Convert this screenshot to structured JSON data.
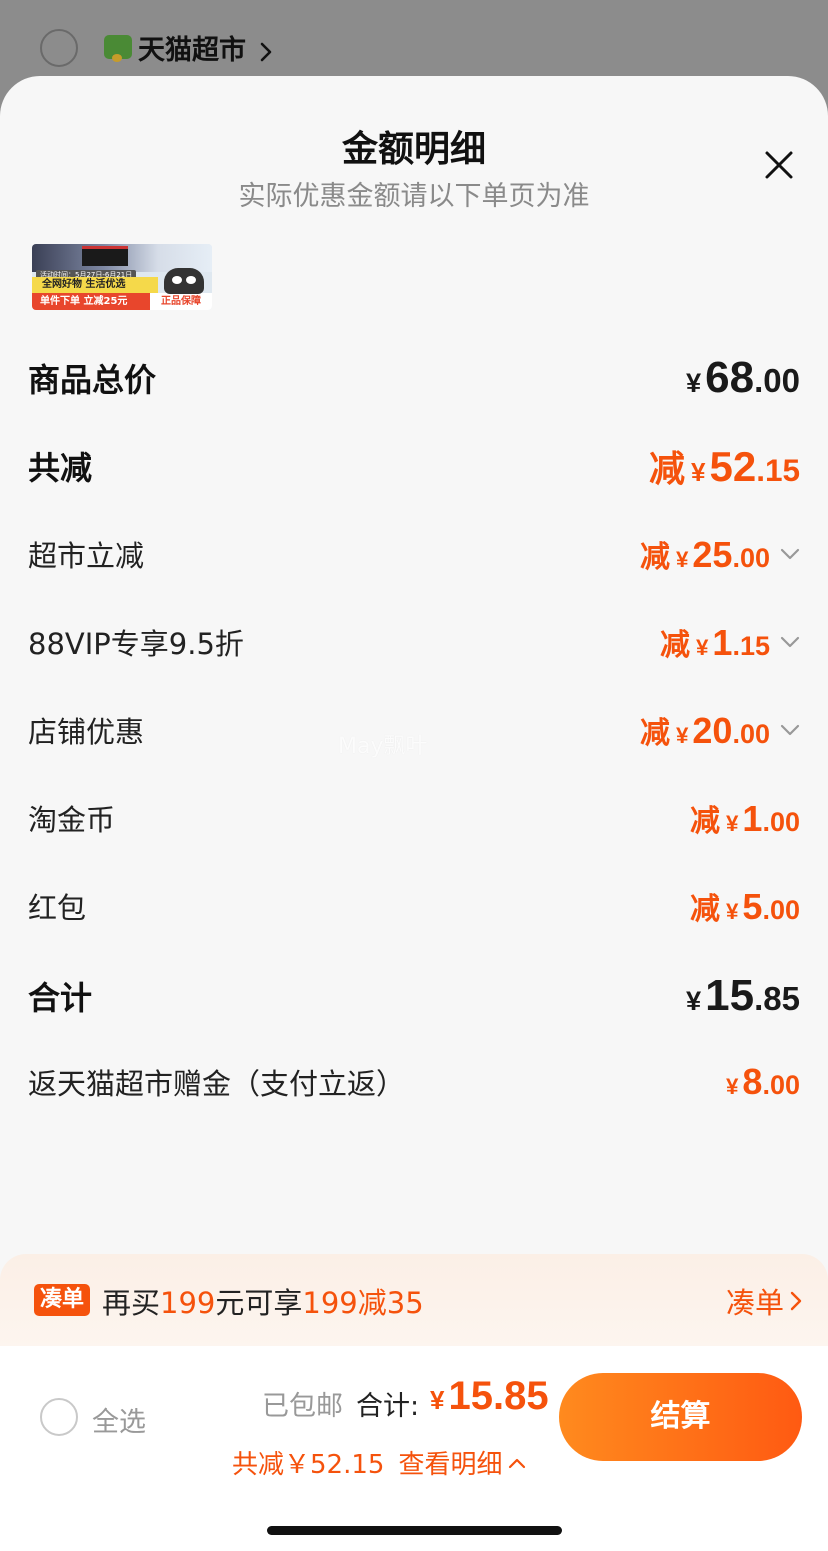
{
  "background": {
    "store_name": "天猫超市",
    "logo_text": "超市"
  },
  "sheet": {
    "title": "金额明细",
    "subtitle": "实际优惠金额请以下单页为准"
  },
  "banner": {
    "date": "活动时间：5月27日-6月21日",
    "line1": "全网好物 生活优选",
    "line2": "单件下单 立减25元",
    "badge": "正品保障"
  },
  "rows": {
    "total_price": {
      "label": "商品总价",
      "yen": "¥",
      "int": "68",
      "dec": ".00"
    },
    "total_reduce": {
      "label": "共减",
      "prefix": "减",
      "yen": "¥",
      "int": "52",
      "dec": ".15"
    },
    "market_reduce": {
      "label": "超市立减",
      "prefix": "减",
      "yen": "¥",
      "int": "25",
      "dec": ".00"
    },
    "vip": {
      "label": "88VIP专享9.5折",
      "prefix": "减",
      "yen": "¥",
      "int": "1",
      "dec": ".15"
    },
    "shop": {
      "label": "店铺优惠",
      "prefix": "减",
      "yen": "¥",
      "int": "20",
      "dec": ".00"
    },
    "coins": {
      "label": "淘金币",
      "prefix": "减",
      "yen": "¥",
      "int": "1",
      "dec": ".00"
    },
    "redpacket": {
      "label": "红包",
      "prefix": "减",
      "yen": "¥",
      "int": "5",
      "dec": ".00"
    },
    "subtotal": {
      "label": "合计",
      "yen": "¥",
      "int": "15",
      "dec": ".85"
    },
    "rebate": {
      "label": "返天猫超市赠金（支付立返）",
      "yen": "¥",
      "int": "8",
      "dec": ".00"
    }
  },
  "coudan": {
    "tag": "凑单",
    "text_a": "再买",
    "text_b": "199",
    "text_c": "元可享",
    "text_d": "199减35",
    "link": "凑单"
  },
  "footer": {
    "select_all": "全选",
    "free_shipping": "已包邮",
    "total_label": "合计:",
    "total_yen": "¥",
    "total_value": "15.85",
    "reduce_text": "共减￥52.15",
    "detail_link": "查看明细",
    "checkout": "结算"
  },
  "watermark": "May飘叶",
  "colors": {
    "accent": "#f5520c",
    "button_start": "#ff8a1e",
    "button_end": "#ff5a12"
  }
}
